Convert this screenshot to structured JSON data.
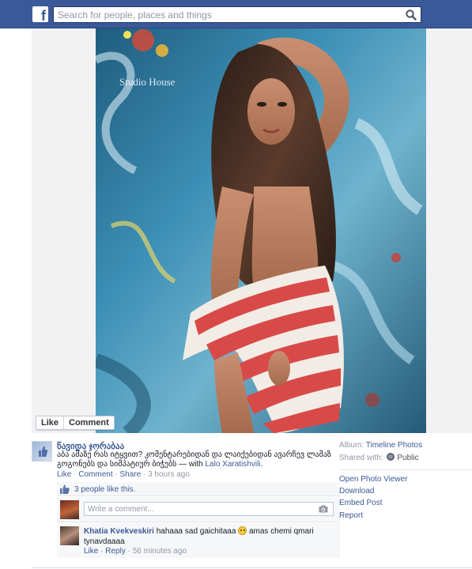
{
  "topbar": {
    "logo_letter": "f",
    "search_placeholder": "Search for people, places and things",
    "colors": {
      "bar": "#3b5998",
      "link": "#3b5998"
    }
  },
  "photo": {
    "like_label": "Like",
    "comment_label": "Comment",
    "watermark": "Studio House"
  },
  "post": {
    "author": "წავიდა ჯორაბაა",
    "caption": "აბა ამაზე რას იტყვით? კომენტარებიდან და ლაიქებიდან ავარჩევ ლამაზ გოგონებს და სიმპატიურ ბიჭებს",
    "with_prefix": "— with",
    "with_name": "Lalo Xaratishvili",
    "with_suffix": ".",
    "actions": {
      "like": "Like",
      "comment": "Comment",
      "share": "Share",
      "time": "3 hours ago"
    },
    "likes_text": "3 people like this.",
    "comment_placeholder": "Write a comment..."
  },
  "comments": [
    {
      "author": "Khatia Kvekveskiri",
      "text_before": "hahaaa sad gaichitaaa",
      "text_after": "amas chemi qmari tynavdaaaa",
      "like": "Like",
      "reply": "Reply",
      "time": "56 minutes ago"
    }
  ],
  "sidebar": {
    "album_label": "Album:",
    "album_name": "Timeline Photos",
    "shared_label": "Shared with:",
    "shared_value": "Public",
    "links": [
      "Open Photo Viewer",
      "Download",
      "Embed Post",
      "Report"
    ]
  }
}
